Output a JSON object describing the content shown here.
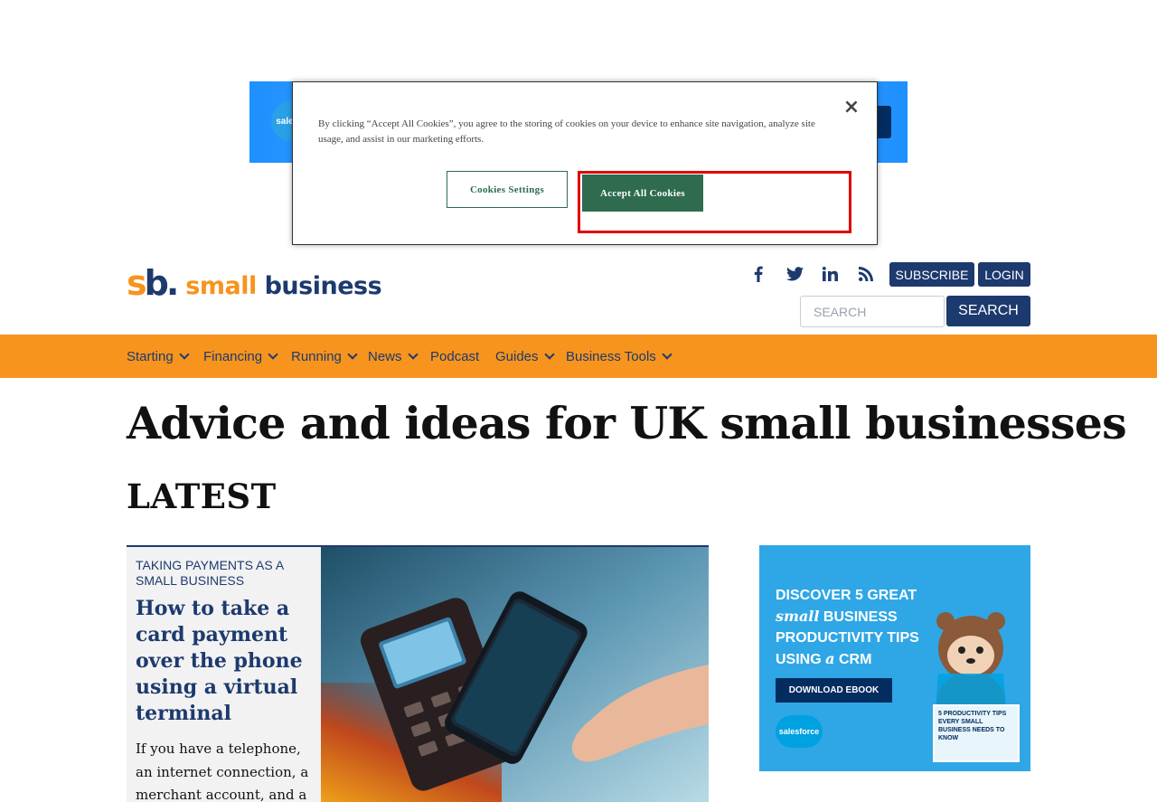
{
  "top_ad": {
    "brand": "salesforce"
  },
  "cookie_banner": {
    "text": "By clicking “Accept All Cookies”, you agree to the storing of cookies on your device to enhance site navigation, analyze site usage, and assist in our marketing efforts.",
    "close_label": "×",
    "settings_label": "Cookies Settings",
    "accept_label": "Accept All Cookies"
  },
  "header": {
    "logo": {
      "mark_s": "s",
      "mark_b": "b.",
      "text_small": "small",
      "text_business": "business"
    },
    "social_icons": [
      "facebook-icon",
      "twitter-icon",
      "linkedin-icon",
      "rss-icon"
    ],
    "subscribe_label": "SUBSCRIBE",
    "login_label": "LOGIN",
    "search_placeholder": "SEARCH",
    "search_button_label": "SEARCH"
  },
  "nav": {
    "items": [
      {
        "label": "Starting"
      },
      {
        "label": "Financing"
      },
      {
        "label": "Running"
      },
      {
        "label": "News"
      },
      {
        "label": "Podcast"
      },
      {
        "label": "Guides"
      },
      {
        "label": "Business Tools"
      }
    ]
  },
  "main": {
    "title": "Advice and ideas for UK small businesses",
    "section_heading": "LATEST",
    "article": {
      "category": "TAKING PAYMENTS AS A SMALL BUSINESS",
      "title": "How to take a card payment over the phone using a virtual terminal",
      "excerpt": "If you have a telephone, an internet connection, a merchant account, and a"
    }
  },
  "side_ad": {
    "line1": "DISCOVER 5 GREAT",
    "line2_em": "small",
    "line2": "BUSINESS",
    "line3": "PRODUCTIVITY TIPS",
    "line4_pre": "USING",
    "line4_em": "a",
    "line4": "CRM",
    "cta": "DOWNLOAD EBOOK",
    "brand": "salesforce",
    "book_text": "5 PRODUCTIVITY TIPS EVERY SMALL BUSINESS NEEDS TO KNOW"
  },
  "colors": {
    "brand_orange": "#f7941d",
    "brand_navy": "#1d3a6e",
    "cookie_green": "#2e6b4f",
    "highlight_red": "#e00000"
  }
}
